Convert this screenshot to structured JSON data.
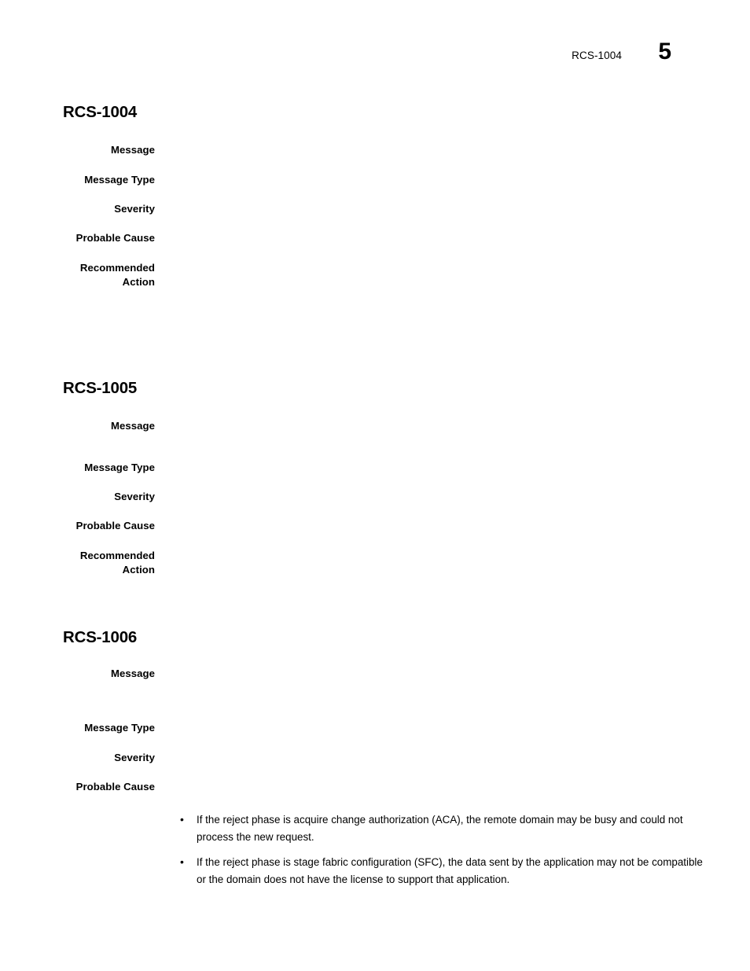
{
  "header": {
    "reference": "RCS-1004",
    "page_number": "5"
  },
  "sections": [
    {
      "id": "rcs-1004",
      "title": "RCS-1004",
      "fields": [
        {
          "label": "Message",
          "value": ""
        },
        {
          "label": "Message Type",
          "value": ""
        },
        {
          "label": "Severity",
          "value": ""
        },
        {
          "label": "Probable Cause",
          "value": ""
        },
        {
          "label": "Recommended\nAction",
          "value": ""
        }
      ]
    },
    {
      "id": "rcs-1005",
      "title": "RCS-1005",
      "fields": [
        {
          "label": "Message",
          "value": ""
        },
        {
          "label": "Message Type",
          "value": ""
        },
        {
          "label": "Severity",
          "value": ""
        },
        {
          "label": "Probable Cause",
          "value": ""
        },
        {
          "label": "Recommended\nAction",
          "value": ""
        }
      ]
    },
    {
      "id": "rcs-1006",
      "title": "RCS-1006",
      "fields": [
        {
          "label": "Message",
          "value": ""
        },
        {
          "label": "Message Type",
          "value": ""
        },
        {
          "label": "Severity",
          "value": ""
        },
        {
          "label": "Probable Cause",
          "value": ""
        }
      ],
      "probable_cause_bullets": [
        "If the reject phase is acquire change authorization (ACA), the remote domain may be busy and could not process the new request.",
        "If the reject phase is stage fabric configuration (SFC), the data sent by the application may not be compatible or the domain does not have the license to support that application."
      ]
    }
  ]
}
